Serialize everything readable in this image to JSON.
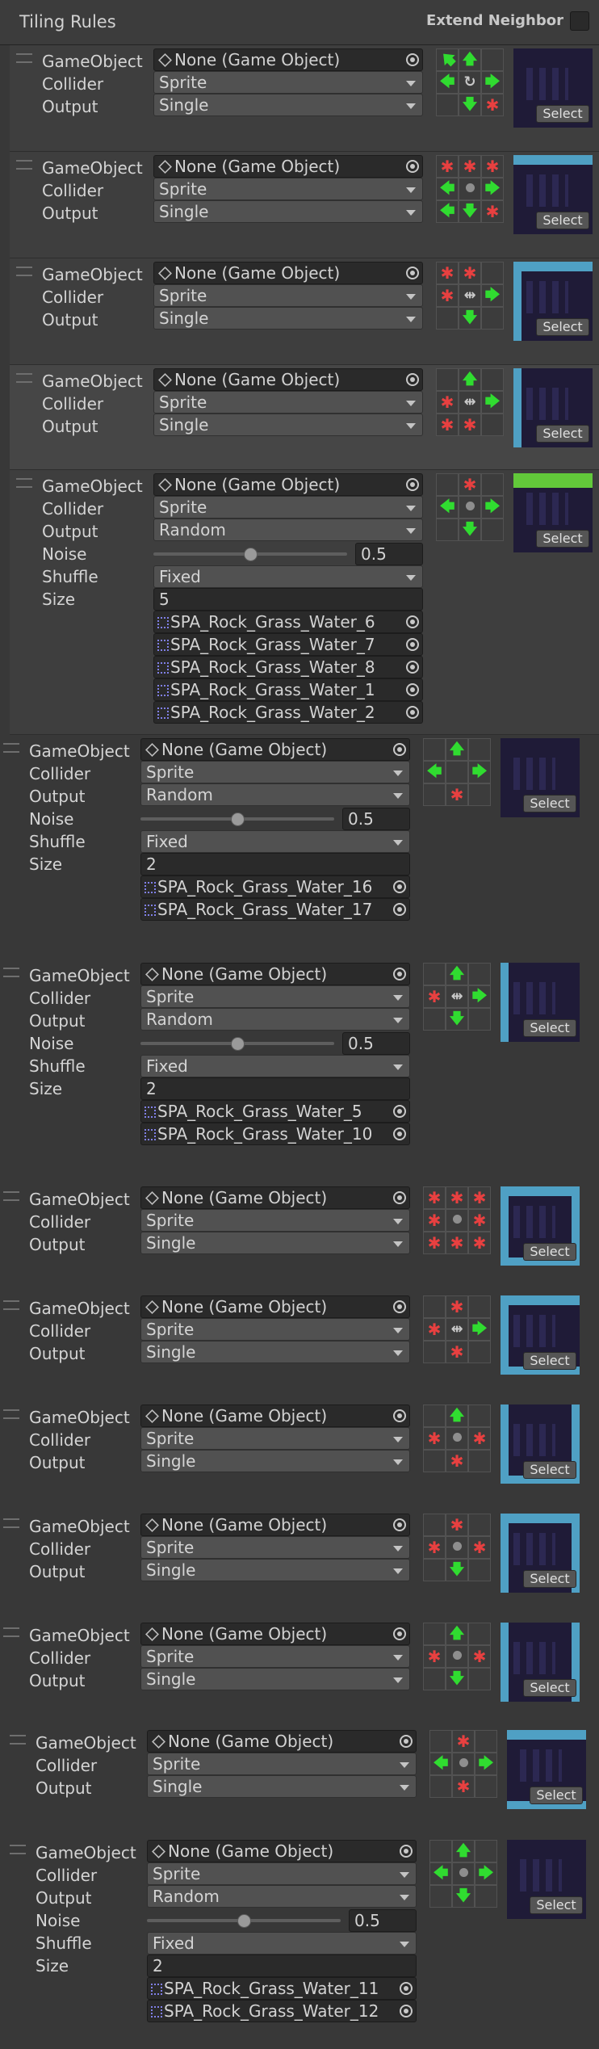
{
  "header": {
    "title": "Tiling Rules",
    "extend_neighbor_label": "Extend Neighbor"
  },
  "labels": {
    "gameobject": "GameObject",
    "collider": "Collider",
    "output": "Output",
    "noise": "Noise",
    "shuffle": "Shuffle",
    "size": "Size",
    "select": "Select"
  },
  "rules": [
    {
      "gameobject": "None (Game Object)",
      "collider": "Sprite",
      "output": "Single",
      "neighbors": [
        "arrow-up-left",
        "arrow-up",
        "",
        "arrow-left",
        "rotate",
        "arrow-right",
        "",
        "arrow-down",
        "x"
      ],
      "thumb": "dark"
    },
    {
      "gameobject": "None (Game Object)",
      "collider": "Sprite",
      "output": "Single",
      "neighbors": [
        "x",
        "x",
        "x",
        "arrow-left",
        "dot",
        "arrow-right",
        "arrow-left",
        "arrow-down",
        "x"
      ],
      "thumb": "top"
    },
    {
      "gameobject": "None (Game Object)",
      "collider": "Sprite",
      "output": "Single",
      "neighbors": [
        "x",
        "x",
        "",
        "x",
        "mirror-x",
        "arrow-right",
        "",
        "arrow-down",
        ""
      ],
      "thumb": "topleft"
    },
    {
      "gameobject": "None (Game Object)",
      "collider": "Sprite",
      "output": "Single",
      "neighbors": [
        "",
        "arrow-up",
        "",
        "x",
        "mirror-x",
        "arrow-right",
        "x",
        "x",
        ""
      ],
      "thumb": "left"
    },
    {
      "gameobject": "None (Game Object)",
      "collider": "Sprite",
      "output": "Random",
      "noise": "0.5",
      "noise_fraction": 0.5,
      "shuffle": "Fixed",
      "size": "5",
      "sprites": [
        "SPA_Rock_Grass_Water_6",
        "SPA_Rock_Grass_Water_7",
        "SPA_Rock_Grass_Water_8",
        "SPA_Rock_Grass_Water_1",
        "SPA_Rock_Grass_Water_2"
      ],
      "neighbors": [
        "",
        "x",
        "",
        "arrow-left",
        "dot",
        "arrow-right",
        "",
        "arrow-down",
        ""
      ],
      "thumb": "grass"
    },
    {
      "gameobject": "None (Game Object)",
      "collider": "Sprite",
      "output": "Random",
      "noise": "0.5",
      "noise_fraction": 0.5,
      "shuffle": "Fixed",
      "size": "2",
      "sprites": [
        "SPA_Rock_Grass_Water_16",
        "SPA_Rock_Grass_Water_17"
      ],
      "neighbors": [
        "",
        "arrow-up",
        "",
        "arrow-left",
        "",
        "arrow-right",
        "",
        "x",
        ""
      ],
      "thumb": "dark"
    },
    {
      "gameobject": "None (Game Object)",
      "collider": "Sprite",
      "output": "Random",
      "noise": "0.5",
      "noise_fraction": 0.5,
      "shuffle": "Fixed",
      "size": "2",
      "sprites": [
        "SPA_Rock_Grass_Water_5",
        "SPA_Rock_Grass_Water_10"
      ],
      "neighbors": [
        "",
        "arrow-up",
        "",
        "x",
        "mirror-x",
        "arrow-right",
        "",
        "arrow-down",
        ""
      ],
      "thumb": "left"
    },
    {
      "gameobject": "None (Game Object)",
      "collider": "Sprite",
      "output": "Single",
      "neighbors": [
        "x",
        "x",
        "x",
        "x",
        "dot",
        "x",
        "x",
        "x",
        "x"
      ],
      "thumb": "all"
    },
    {
      "gameobject": "None (Game Object)",
      "collider": "Sprite",
      "output": "Single",
      "neighbors": [
        "",
        "x",
        "",
        "x",
        "mirror-x",
        "arrow-right",
        "",
        "x",
        ""
      ],
      "thumb": "topleftbottom"
    },
    {
      "gameobject": "None (Game Object)",
      "collider": "Sprite",
      "output": "Single",
      "neighbors": [
        "",
        "arrow-up",
        "",
        "x",
        "dot",
        "x",
        "",
        "x",
        ""
      ],
      "thumb": "sidesbottom"
    },
    {
      "gameobject": "None (Game Object)",
      "collider": "Sprite",
      "output": "Single",
      "neighbors": [
        "",
        "x",
        "",
        "x",
        "dot",
        "x",
        "",
        "arrow-down",
        ""
      ],
      "thumb": "topsides"
    },
    {
      "gameobject": "None (Game Object)",
      "collider": "Sprite",
      "output": "Single",
      "neighbors": [
        "",
        "arrow-up",
        "",
        "x",
        "dot",
        "x",
        "",
        "arrow-down",
        ""
      ],
      "thumb": "sides"
    },
    {
      "gameobject": "None (Game Object)",
      "collider": "Sprite",
      "output": "Single",
      "neighbors": [
        "",
        "x",
        "",
        "arrow-left",
        "dot",
        "arrow-right",
        "",
        "x",
        ""
      ],
      "thumb": "topbottom"
    },
    {
      "gameobject": "None (Game Object)",
      "collider": "Sprite",
      "output": "Random",
      "noise": "0.5",
      "noise_fraction": 0.5,
      "shuffle": "Fixed",
      "size": "2",
      "sprites": [
        "SPA_Rock_Grass_Water_11",
        "SPA_Rock_Grass_Water_12"
      ],
      "neighbors": [
        "",
        "arrow-up",
        "",
        "arrow-left",
        "dot",
        "arrow-right",
        "",
        "arrow-down",
        ""
      ],
      "thumb": "dark"
    }
  ]
}
